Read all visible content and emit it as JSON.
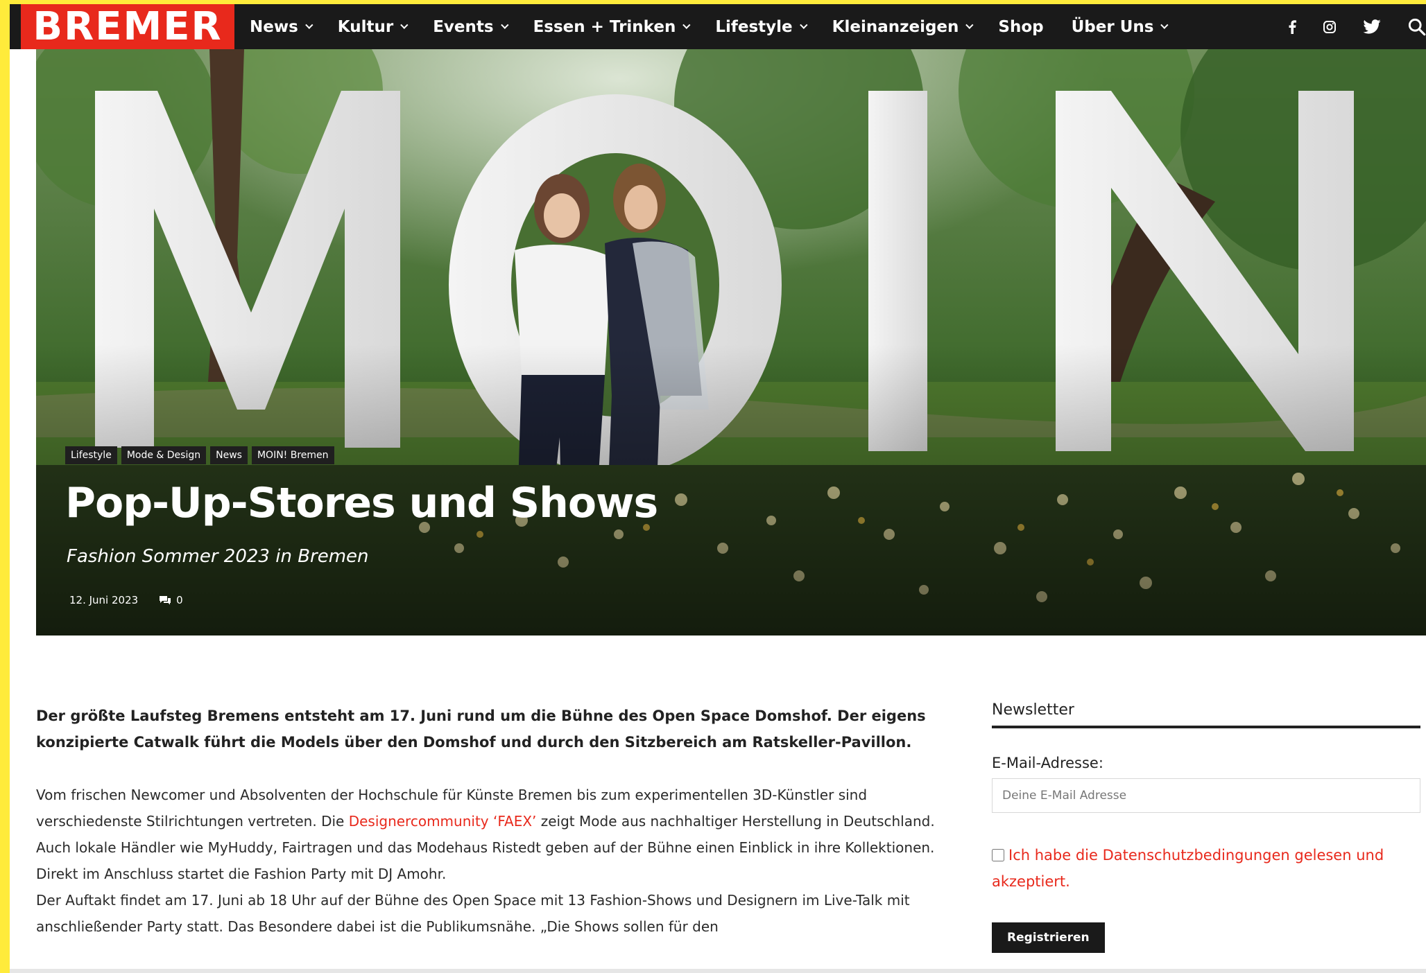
{
  "brand": {
    "logo_text": "BREMER",
    "accent": "#e8291c"
  },
  "nav": {
    "items": [
      {
        "label": "News",
        "dropdown": true
      },
      {
        "label": "Kultur",
        "dropdown": true
      },
      {
        "label": "Events",
        "dropdown": true
      },
      {
        "label": "Essen + Trinken",
        "dropdown": true
      },
      {
        "label": "Lifestyle",
        "dropdown": true
      },
      {
        "label": "Kleinanzeigen",
        "dropdown": true
      },
      {
        "label": "Shop",
        "dropdown": false
      },
      {
        "label": "Über Uns",
        "dropdown": true
      }
    ],
    "icons": [
      "facebook-icon",
      "instagram-icon",
      "twitter-icon",
      "search-icon"
    ]
  },
  "hero": {
    "sign_letters": "MOIN",
    "tags": [
      "Lifestyle",
      "Mode & Design",
      "News",
      "MOIN! Bremen"
    ],
    "title": "Pop-Up-Stores und Shows",
    "subtitle": "Fashion Sommer 2023 in Bremen",
    "date": "12. Juni 2023",
    "comments": "0"
  },
  "article": {
    "lead": "Der größte Laufsteg Bremens entsteht am 17. Juni rund um die Bühne des Open Space Domshof. Der eigens konzipierte Catwalk führt die Models über den Domshof und durch den Sitzbereich am Ratskeller-Pavillon.",
    "p1_before": "Vom frischen Newcomer und Absolventen der Hochschule für Künste Bremen bis zum experimentellen 3D-Künstler sind verschiedenste Stilrichtungen vertreten. Die ",
    "p1_link": "Designercommunity ‘FAEX’",
    "p1_after": " zeigt Mode aus nachhaltiger Herstellung in Deutschland. Auch lokale Händler wie MyHuddy, Fairtragen und das Modehaus Ristedt geben auf der Bühne einen Einblick in ihre Kollektionen. Direkt im Anschluss startet die Fashion Party mit DJ Amohr.",
    "p2": "Der Auftakt findet am 17. Juni ab 18 Uhr auf der Bühne des Open Space mit 13 Fashion-Shows und Designern im Live-Talk mit anschließender Party statt. Das Besondere dabei ist die Publikumsnähe. „Die Shows sollen für den"
  },
  "sidebar": {
    "title": "Newsletter",
    "email_label": "E-Mail-Adresse:",
    "email_placeholder": "Deine E-Mail Adresse",
    "consent": "Ich habe die Datenschutzbedingungen gelesen und akzeptiert.",
    "button": "Registrieren"
  }
}
